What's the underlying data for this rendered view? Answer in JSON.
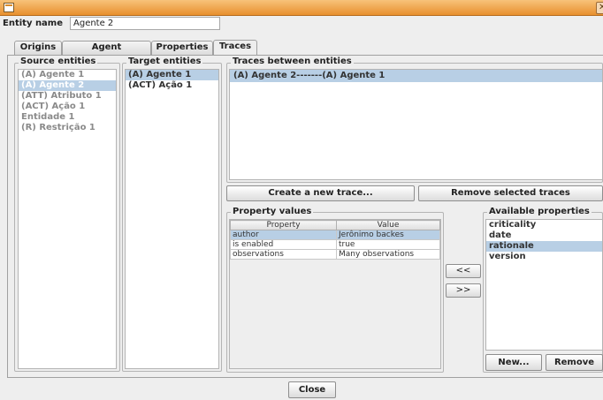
{
  "window": {
    "title": "",
    "close_icon": "close-icon",
    "app_icon": "java-app-icon"
  },
  "entity": {
    "label": "Entity name",
    "value": "Agente 2"
  },
  "tabs": [
    "Origins",
    "Agent components",
    "Properties",
    "Traces"
  ],
  "active_tab": "Traces",
  "source": {
    "title": "Source entities",
    "items": [
      "(A) Agente 1",
      "(A) Agente 2",
      "(ATT) Atributo 1",
      "(ACT) Ação 1",
      "Entidade 1",
      "(R) Restrição 1"
    ],
    "selected": "(A) Agente 2"
  },
  "target": {
    "title": "Target entities",
    "items": [
      "(A) Agente 1",
      "(ACT) Ação 1"
    ],
    "selected": "(A) Agente 1"
  },
  "traces": {
    "title": "Traces between entities",
    "items": [
      "(A) Agente 2-------(A) Agente 1"
    ],
    "create_label": "Create a new trace...",
    "remove_label": "Remove selected traces"
  },
  "property_values": {
    "title": "Property values",
    "headers": [
      "Property",
      "Value"
    ],
    "rows": [
      [
        "author",
        "Jerônimo backes"
      ],
      [
        "is enabled",
        "true"
      ],
      [
        "observations",
        "Many observations"
      ]
    ]
  },
  "move": {
    "left_label": "<<",
    "right_label": ">>"
  },
  "available": {
    "title": "Available properties",
    "items": [
      "criticality",
      "date",
      "rationale",
      "version"
    ],
    "selected": "rationale",
    "new_label": "New...",
    "remove_label": "Remove"
  },
  "close_label": "Close",
  "colors": {
    "selection": "#b8cfe5",
    "titlebar": "#e8902e",
    "background": "#eeeeee"
  }
}
